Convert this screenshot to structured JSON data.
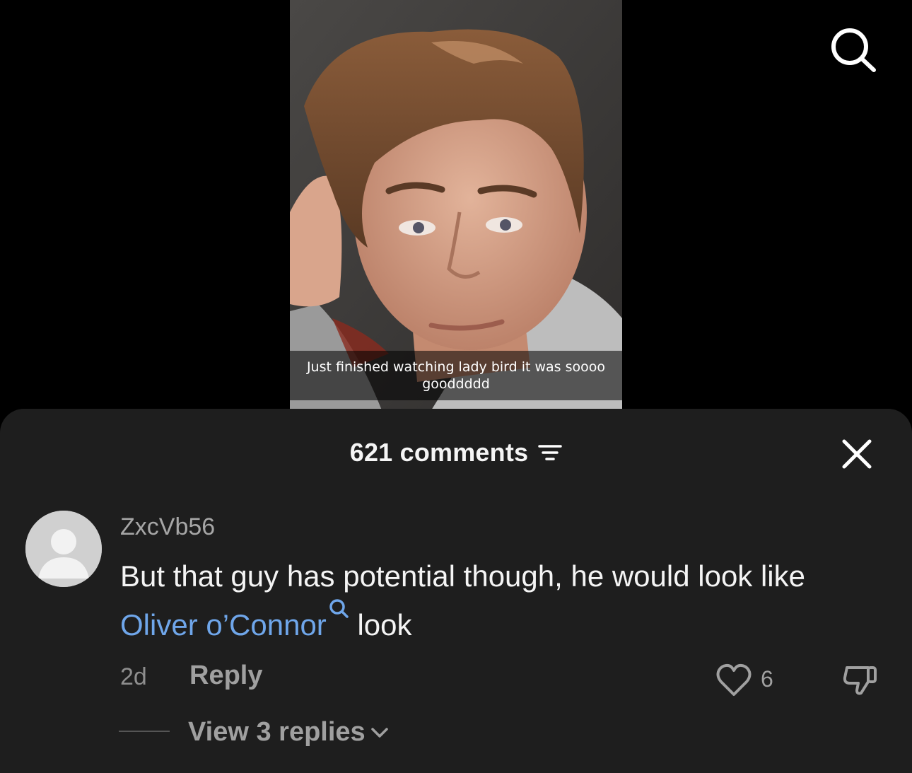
{
  "video": {
    "caption_line1": "Just finished watching lady bird it was soooo",
    "caption_line2": "gooddddd"
  },
  "top_bar": {
    "search_icon": "search-icon"
  },
  "comments_sheet": {
    "count_label": "621 comments",
    "filter_icon": "filter-icon",
    "close_icon": "close-icon",
    "comment": {
      "username": "ZxcVb56",
      "text_before": "But that guy has potential though, he would look like ",
      "mention": "Oliver o’Connor",
      "text_after": " look",
      "timestamp": "2d",
      "reply_label": "Reply",
      "like_count": "6",
      "view_replies_label": "View 3 replies"
    }
  },
  "colors": {
    "sheet_bg": "#1e1e1e",
    "mention": "#6fa6ea",
    "muted_text": "#a0a0a0"
  }
}
